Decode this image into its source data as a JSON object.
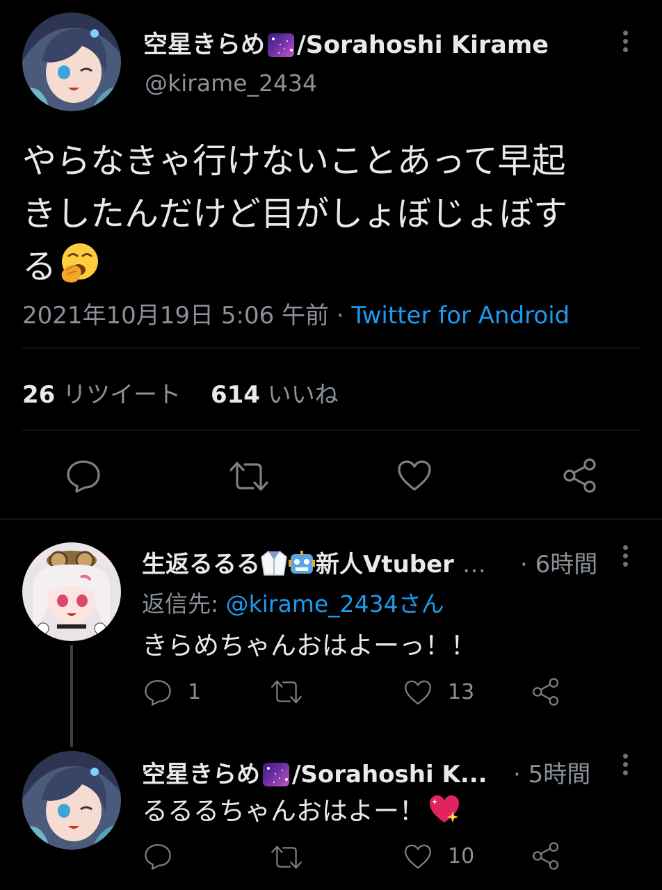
{
  "main_tweet": {
    "display_name": "空星きらめ",
    "display_name_suffix": "/Sorahoshi Kirame",
    "handle": "@kirame_2434",
    "text_line1": "やらなきゃ行けないことあって早起",
    "text_line2": "きしたんだけど目がしょぼじょぼす",
    "text_line3": "る",
    "timestamp": "2021年10月19日 5:06 午前",
    "separator": "·",
    "source": "Twitter for Android",
    "retweet_count": "26",
    "retweet_label": "リツイート",
    "like_count": "614",
    "like_label": "いいね"
  },
  "replies": [
    {
      "display_name": "生返るるる",
      "display_name_suffix": "新人Vtuber",
      "ellipsis": "…",
      "time": "· 6時間",
      "reply_to_label": "返信先:",
      "reply_to_handle": "@kirame_2434さん",
      "text": "きらめちゃんおはよーっ！！",
      "reply_count": "1",
      "like_count": "13"
    },
    {
      "display_name": "空星きらめ",
      "display_name_suffix": "/Sorahoshi K...",
      "time": "· 5時間",
      "text": "るるるちゃんおはよー！",
      "like_count": "10"
    }
  ],
  "colors": {
    "background": "#000000",
    "text": "#e7e9ea",
    "muted": "#8b9198",
    "link": "#1d9bf0",
    "divider": "#2f3336"
  },
  "icons": {
    "more": "more-vertical-icon",
    "reply": "reply-bubble-icon",
    "retweet": "retweet-icon",
    "like": "heart-icon",
    "share": "share-icon",
    "yawn": "yawning-face-emoji",
    "galaxy": "milky-way-emoji",
    "labcoat": "lab-coat-emoji",
    "robot": "robot-emoji",
    "sparkling_heart": "sparkling-heart-emoji"
  }
}
